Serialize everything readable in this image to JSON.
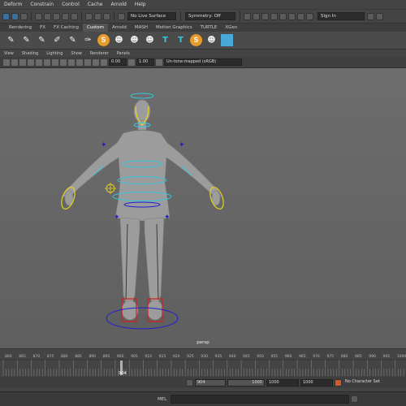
{
  "menubar": {
    "items": [
      "Deform",
      "Constrain",
      "Control",
      "Cache",
      "Arnold",
      "Help"
    ]
  },
  "status": {
    "live_surface": "No Live Surface",
    "symmetry": "Symmetry: Off",
    "sign_in": "Sign In"
  },
  "shelf_tabs": [
    "Rendering",
    "FX",
    "FX Caching",
    "Custom",
    "Arnold",
    "MASH",
    "Motion Graphics",
    "TURTLE",
    "XGen"
  ],
  "panel_menu": [
    "View",
    "Shading",
    "Lighting",
    "Show",
    "Renderer",
    "Panels"
  ],
  "panel_toolbar": {
    "field1": "0.00",
    "field2": "1.00",
    "colorspace": "Un-tone-mapped (sRGB)"
  },
  "viewport": {
    "camera": "persp"
  },
  "timeline": {
    "ticks": [
      "860",
      "865",
      "870",
      "875",
      "880",
      "885",
      "890",
      "895",
      "900",
      "905",
      "910",
      "915",
      "920",
      "925",
      "930",
      "935",
      "940",
      "945",
      "950",
      "955",
      "960",
      "965",
      "970",
      "975",
      "980",
      "985",
      "990",
      "995",
      "1000"
    ],
    "current_frame": "904"
  },
  "range": {
    "start": "904",
    "end": "1000",
    "anim_end": "1000",
    "anim_end2": "1000",
    "character_set": "No Character Set"
  },
  "command": {
    "label": "MEL"
  },
  "colors": {
    "control_cyan": "#34c8e0",
    "control_yellow": "#e8d020",
    "control_blue": "#1d1dd0",
    "control_red": "#d02020",
    "body": "#9a9a9a"
  }
}
